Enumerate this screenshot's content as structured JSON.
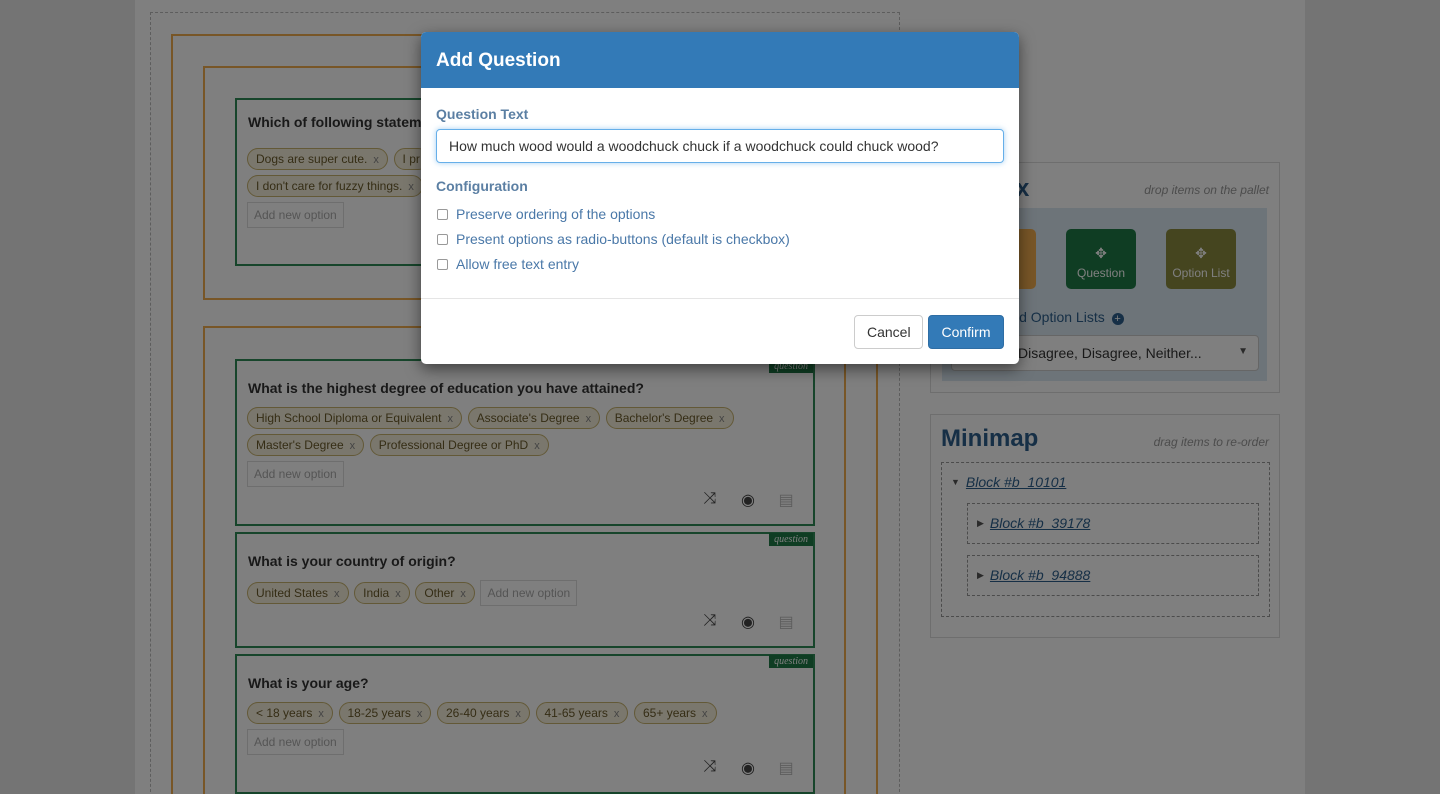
{
  "questions": [
    {
      "title": "Which of following statem",
      "options": [
        "Dogs are super cute.",
        "I pr",
        "I don't care for fuzzy things."
      ],
      "add_placeholder": "Add new option"
    },
    {
      "tag": "question",
      "title": "What is the highest degree of education you have attained?",
      "options": [
        "High School Diploma or Equivalent",
        "Associate's Degree",
        "Bachelor's Degree",
        "Master's Degree",
        "Professional Degree or PhD"
      ],
      "add_placeholder": "Add new option"
    },
    {
      "tag": "question",
      "title": "What is your country of origin?",
      "options": [
        "United States",
        "India",
        "Other"
      ],
      "add_placeholder": "Add new option"
    },
    {
      "tag": "question",
      "title": "What is your age?",
      "options": [
        "< 18 years",
        "18-25 years",
        "26-40 years",
        "41-65 years",
        "65+ years"
      ],
      "add_placeholder": "Add new option"
    }
  ],
  "remove_glyph": "x",
  "toolbox": {
    "title_fragment": "x",
    "hint": "drop items on the pallet",
    "tools": [
      "Question",
      "Option List"
    ],
    "option_lists_label": "ld Option Lists",
    "select_value": "Disagree, Disagree, Neither...",
    "colors": {
      "block": "#f0ad4e",
      "question": "#1e7b46",
      "option_list": "#8a8a3f"
    }
  },
  "minimap": {
    "title": "Minimap",
    "hint": "drag items to re-order",
    "root": "Block #b_10101",
    "children": [
      "Block #b_39178",
      "Block #b_94888"
    ]
  },
  "modal": {
    "title": "Add Question",
    "question_text_label": "Question Text",
    "question_text_value": "How much wood would a woodchuck chuck if a woodchuck could chuck wood?",
    "configuration_label": "Configuration",
    "checkboxes": [
      {
        "label": "Preserve ordering of the options",
        "checked": false
      },
      {
        "label": "Present options as radio-buttons (default is checkbox)",
        "checked": false
      },
      {
        "label": "Allow free text entry",
        "checked": false
      }
    ],
    "cancel_label": "Cancel",
    "confirm_label": "Confirm",
    "accent_color": "#337ab7"
  }
}
